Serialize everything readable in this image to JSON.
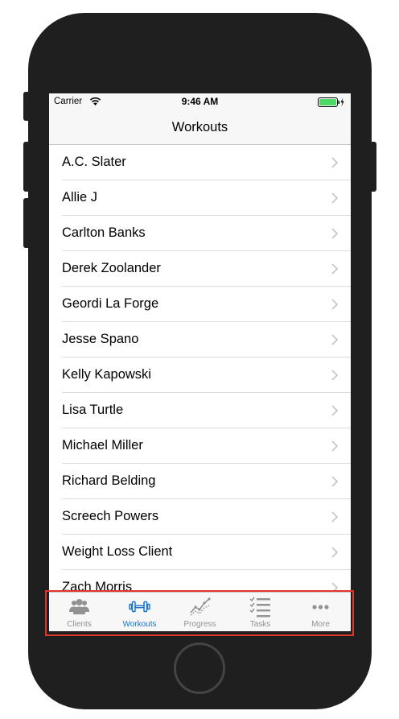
{
  "status_bar": {
    "carrier": "Carrier",
    "time": "9:46 AM",
    "battery_color": "#4cd964"
  },
  "nav": {
    "title": "Workouts"
  },
  "clients": [
    {
      "name": "A.C. Slater"
    },
    {
      "name": "Allie J"
    },
    {
      "name": "Carlton Banks"
    },
    {
      "name": "Derek Zoolander"
    },
    {
      "name": "Geordi La Forge"
    },
    {
      "name": "Jesse Spano"
    },
    {
      "name": "Kelly Kapowski"
    },
    {
      "name": "Lisa Turtle"
    },
    {
      "name": "Michael Miller"
    },
    {
      "name": "Richard Belding"
    },
    {
      "name": "Screech Powers"
    },
    {
      "name": "Weight Loss Client"
    },
    {
      "name": "Zach Morris"
    }
  ],
  "tab_bar": {
    "tabs": [
      {
        "label": "Clients",
        "icon": "clients-icon"
      },
      {
        "label": "Workouts",
        "icon": "dumbbell-icon",
        "active": true
      },
      {
        "label": "Progress",
        "icon": "progress-icon"
      },
      {
        "label": "Tasks",
        "icon": "tasks-icon"
      },
      {
        "label": "More",
        "icon": "more-icon"
      }
    ],
    "active_color": "#1b72c9",
    "inactive_color": "#929292"
  },
  "annotation": {
    "highlight_color": "#e0362c"
  }
}
